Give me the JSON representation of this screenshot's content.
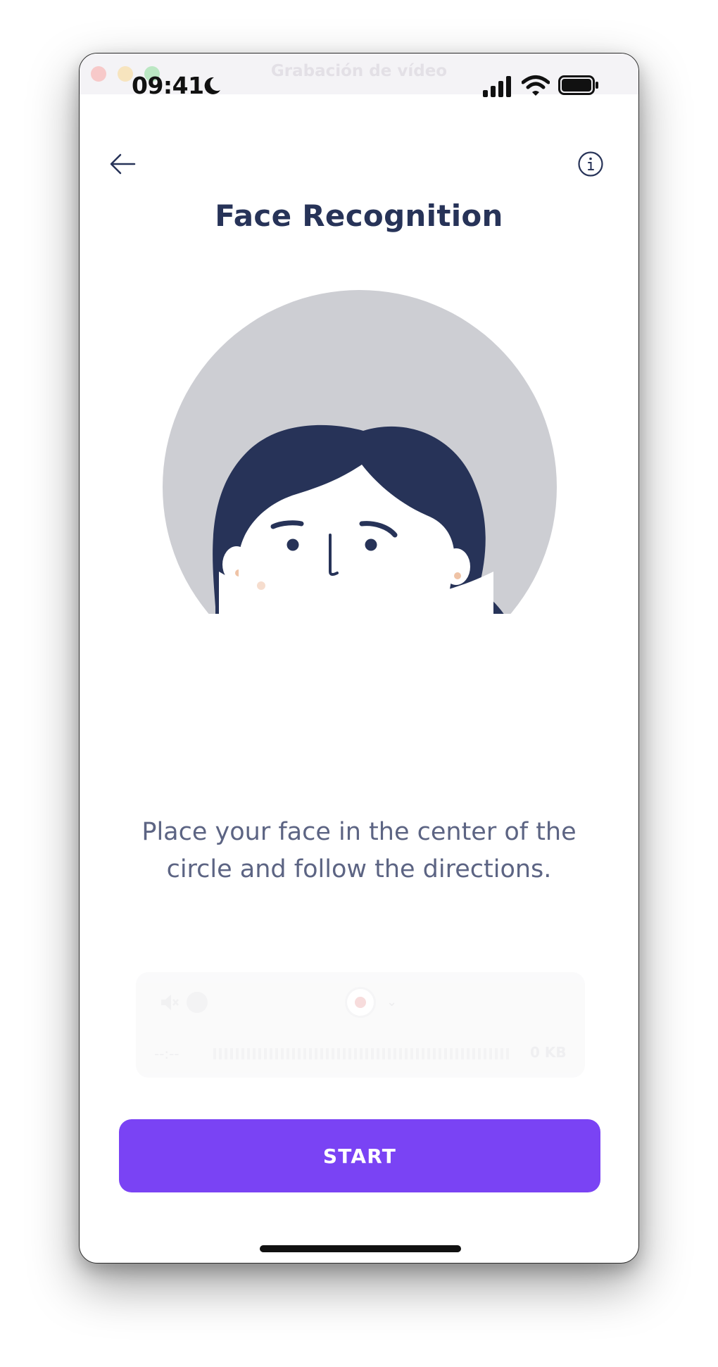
{
  "window": {
    "title": "Grabación de vídeo"
  },
  "status_bar": {
    "time": "09:41"
  },
  "header": {
    "title": "Face Recognition",
    "back_icon": "arrow-left-icon",
    "info_icon": "info-circle-icon"
  },
  "illustration": {
    "circle_color": "#cdced3",
    "hair_color": "#273358"
  },
  "instructions": {
    "text": "Place your face in the center of the circle and follow the directions."
  },
  "recorder": {
    "time": "--:--",
    "size": "0 KB"
  },
  "actions": {
    "start_label": "START"
  },
  "colors": {
    "accent": "#7a43f4",
    "title": "#273358",
    "body_text": "#5c6483"
  }
}
